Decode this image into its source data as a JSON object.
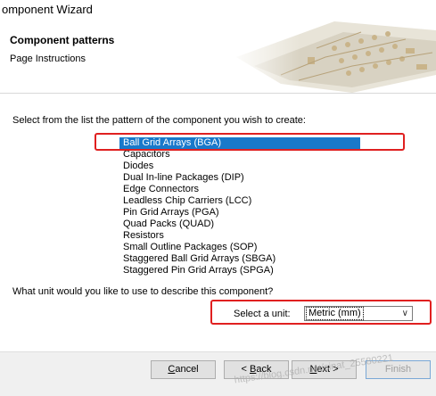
{
  "window": {
    "title": "omponent Wizard"
  },
  "header": {
    "title": "Component patterns",
    "subtitle": "Page Instructions"
  },
  "main": {
    "prompt_pattern": "Select from the list the pattern of the component you wish to create:",
    "patterns": [
      "Ball Grid Arrays (BGA)",
      "Capacitors",
      "Diodes",
      "Dual In-line Packages (DIP)",
      "Edge Connectors",
      "Leadless Chip Carriers (LCC)",
      "Pin Grid Arrays (PGA)",
      "Quad Packs (QUAD)",
      "Resistors",
      "Small Outline Packages (SOP)",
      "Staggered Ball Grid Arrays (SBGA)",
      "Staggered Pin Grid Arrays (SPGA)"
    ],
    "selected_pattern": "Ball Grid Arrays (BGA)",
    "prompt_unit": "What unit would you like to use to describe this component?",
    "unit_label": "Select a unit:",
    "unit_value": "Metric (mm)"
  },
  "footer": {
    "cancel": {
      "pre": "",
      "key": "C",
      "post": "ancel"
    },
    "back": {
      "pre": "< ",
      "key": "B",
      "post": "ack"
    },
    "next": {
      "pre": "",
      "key": "N",
      "post": "ext >"
    },
    "finish": "Finish",
    "watermark": "https://blog.csdn.net/sinat_25580221"
  },
  "colors": {
    "selection": "#1979ca",
    "highlight_box": "#e02020",
    "footer_bg": "#f0f0f0"
  }
}
